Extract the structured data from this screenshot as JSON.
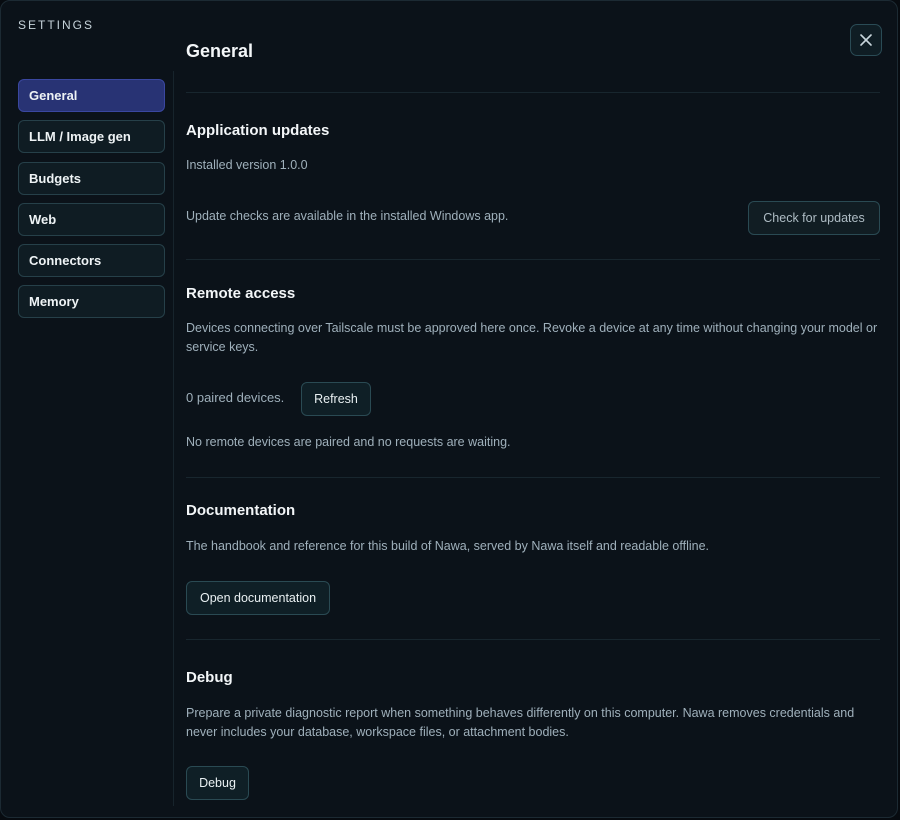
{
  "header": {
    "settings_label": "SETTINGS",
    "page_title": "General",
    "close_icon": "close-icon"
  },
  "sidebar": {
    "items": [
      {
        "label": "General",
        "active": true
      },
      {
        "label": "LLM / Image gen",
        "active": false
      },
      {
        "label": "Budgets",
        "active": false
      },
      {
        "label": "Web",
        "active": false
      },
      {
        "label": "Connectors",
        "active": false
      },
      {
        "label": "Memory",
        "active": false
      }
    ]
  },
  "sections": {
    "updates": {
      "title": "Application updates",
      "version_text": "Installed version 1.0.0",
      "info_text": "Update checks are available in the installed Windows app.",
      "button_label": "Check for updates"
    },
    "remote": {
      "title": "Remote access",
      "description": "Devices connecting over Tailscale must be approved here once. Revoke a device at any time without changing your model or service keys.",
      "paired_text": "0 paired devices.",
      "refresh_label": "Refresh",
      "status_text": "No remote devices are paired and no requests are waiting."
    },
    "docs": {
      "title": "Documentation",
      "description": "The handbook and reference for this build of Nawa, served by Nawa itself and readable offline.",
      "button_label": "Open documentation"
    },
    "debug": {
      "title": "Debug",
      "description": "Prepare a private diagnostic report when something behaves differently on this computer. Nawa removes credentials and never includes your database, workspace files, or attachment bodies.",
      "button_label": "Debug"
    }
  },
  "colors": {
    "background": "#0b1219",
    "accent_active": "#283374",
    "button_border": "#2a4a53"
  }
}
